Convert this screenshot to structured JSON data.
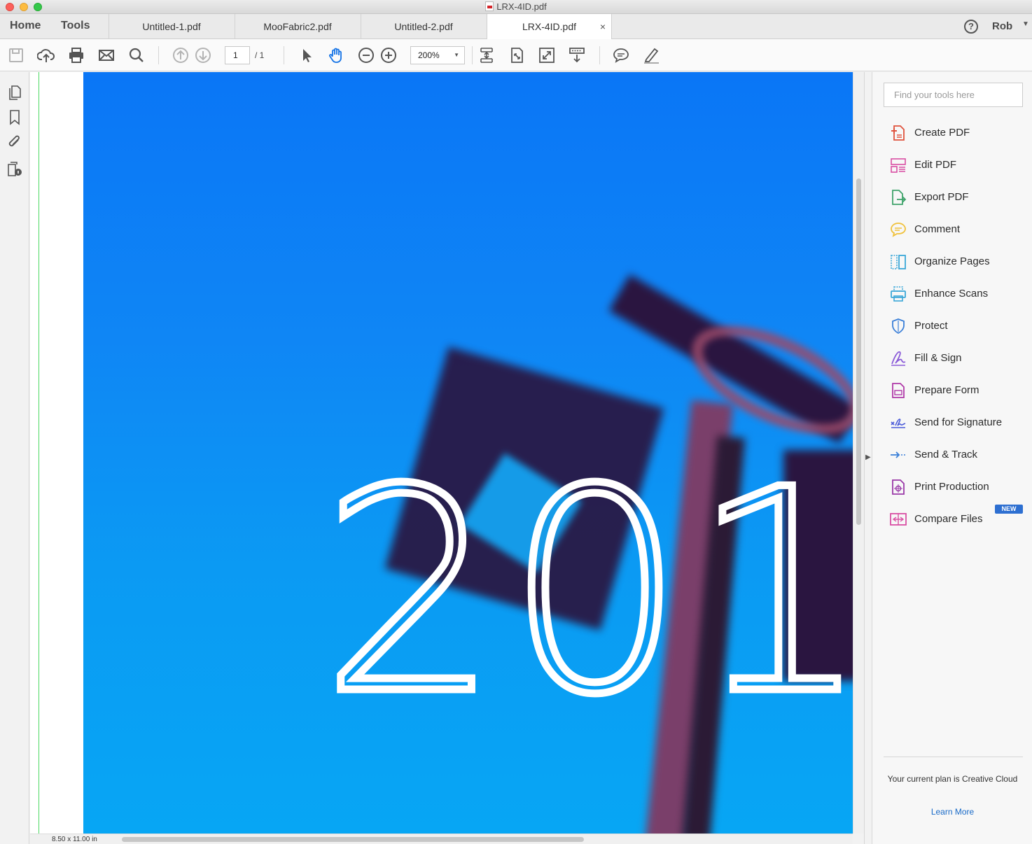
{
  "window": {
    "title": "LRX-4ID.pdf"
  },
  "nav": {
    "home": "Home",
    "tools": "Tools"
  },
  "tabs": [
    {
      "label": "Untitled-1.pdf"
    },
    {
      "label": "MooFabric2.pdf"
    },
    {
      "label": "Untitled-2.pdf"
    },
    {
      "label": "LRX-4ID.pdf",
      "close": "×"
    }
  ],
  "account": {
    "help": "?",
    "user": "Rob"
  },
  "toolbar": {
    "page_current": "1",
    "page_total": "/ 1",
    "zoom": "200%",
    "icons": [
      "save-icon",
      "cloud-upload-icon",
      "print-icon",
      "email-icon",
      "search-icon",
      "prev-page-icon",
      "next-page-icon",
      "select-cursor-icon",
      "hand-tool-icon",
      "zoom-out-icon",
      "zoom-in-icon",
      "scroll-mode-icon",
      "fit-page-icon",
      "full-screen-icon",
      "read-mode-icon",
      "comment-icon",
      "highlight-icon"
    ]
  },
  "document": {
    "big_text": "201",
    "page_size": "8.50 x 11.00 in"
  },
  "tools_pane": {
    "search_placeholder": "Find your tools here",
    "items": [
      {
        "label": "Create PDF",
        "icon": "create-pdf-icon",
        "color": "#e0533e"
      },
      {
        "label": "Edit PDF",
        "icon": "edit-pdf-icon",
        "color": "#d94fa3"
      },
      {
        "label": "Export PDF",
        "icon": "export-pdf-icon",
        "color": "#3fa36b"
      },
      {
        "label": "Comment",
        "icon": "comment-tool-icon",
        "color": "#f0c13a"
      },
      {
        "label": "Organize Pages",
        "icon": "organize-pages-icon",
        "color": "#3aa7d8"
      },
      {
        "label": "Enhance Scans",
        "icon": "enhance-scans-icon",
        "color": "#3aa7d8"
      },
      {
        "label": "Protect",
        "icon": "protect-icon",
        "color": "#3a7fd8"
      },
      {
        "label": "Fill & Sign",
        "icon": "fill-sign-icon",
        "color": "#8a5ad8"
      },
      {
        "label": "Prepare Form",
        "icon": "prepare-form-icon",
        "color": "#b03aa8"
      },
      {
        "label": "Send for Signature",
        "icon": "send-signature-icon",
        "color": "#4a5ad8"
      },
      {
        "label": "Send & Track",
        "icon": "send-track-icon",
        "color": "#3a7fd8"
      },
      {
        "label": "Print Production",
        "icon": "print-production-icon",
        "color": "#9a3aa8"
      },
      {
        "label": "Compare Files",
        "icon": "compare-files-icon",
        "color": "#d94fa3"
      }
    ],
    "new_badge": "NEW",
    "plan_text": "Your current plan is Creative Cloud",
    "learn_more": "Learn More"
  }
}
